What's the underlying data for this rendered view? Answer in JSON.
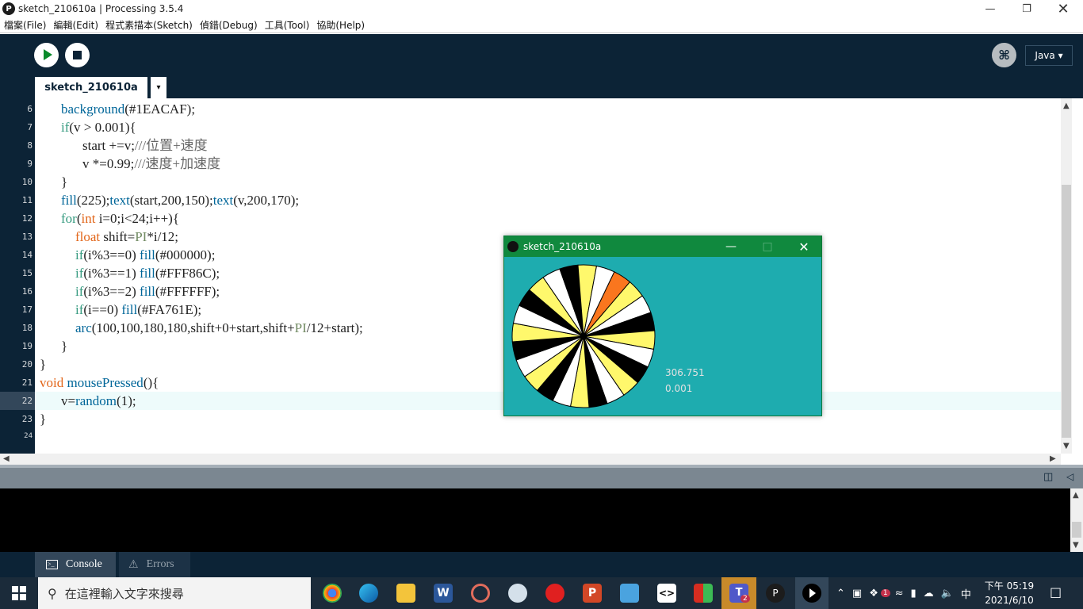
{
  "window": {
    "title": "sketch_210610a | Processing 3.5.4",
    "logo": "P"
  },
  "menu": [
    "檔案(File)",
    "編輯(Edit)",
    "程式素描本(Sketch)",
    "偵錯(Debug)",
    "工具(Tool)",
    "協助(Help)"
  ],
  "toolbar": {
    "mode_label": "Java ▾",
    "run_icon": "play-icon",
    "stop_icon": "stop-icon",
    "debug_icon": "butterfly-icon"
  },
  "tab": {
    "name": "sketch_210610a",
    "menu_glyph": "▾"
  },
  "code": {
    "line_numbers": [
      "6",
      "7",
      "8",
      "9",
      "10",
      "11",
      "12",
      "13",
      "14",
      "15",
      "16",
      "17",
      "18",
      "19",
      "20",
      "21",
      "22",
      "23",
      "24"
    ],
    "active_line": "22",
    "l6": {
      "fn": "background",
      "rest": "(#1EACAF);"
    },
    "l7": {
      "kw": "if",
      "rest": "(v > 0.001){"
    },
    "l8": {
      "code": "start +=v;",
      "comment": "///位置+速度"
    },
    "l9": {
      "code": "v *=0.99;",
      "comment": "///速度+加速度"
    },
    "l10": "}",
    "l11": {
      "fn1": "fill",
      "a1": "(225);",
      "fn2": "text",
      "a2": "(start,200,150);",
      "fn3": "text",
      "a3": "(v,200,170);"
    },
    "l12": {
      "kw": "for",
      "p1": "(",
      "ty": "int",
      "rest": " i=0;i<24;i++){"
    },
    "l13": {
      "ty": "float",
      "mid": " shift=",
      "const": "PI",
      "rest": "*i/12;"
    },
    "l14": {
      "kw": "if",
      "a": "(i%3==0) ",
      "fn": "fill",
      "b": "(#000000);"
    },
    "l15": {
      "kw": "if",
      "a": "(i%3==1) ",
      "fn": "fill",
      "b": "(#FFF86C);"
    },
    "l16": {
      "kw": "if",
      "a": "(i%3==2) ",
      "fn": "fill",
      "b": "(#FFFFFF);"
    },
    "l17": {
      "kw": "if",
      "a": "(i==0) ",
      "fn": "fill",
      "b": "(#FA761E);"
    },
    "l18": {
      "fn": "arc",
      "a": "(100,100,180,180,shift+0+start,shift+",
      "const": "PI",
      "b": "/12+start);"
    },
    "l19": "}",
    "l20": "}",
    "l21": {
      "ty": "void",
      "fn": "mousePressed",
      "rest": "(){"
    },
    "l22": {
      "a": "v=",
      "fn": "random",
      "b": "(1);"
    },
    "l23": "}"
  },
  "sketch_window": {
    "title": "sketch_210610a",
    "text_start": "306.751",
    "text_v": "0.001",
    "colors": {
      "bg": "#1EACAF",
      "black": "#000000",
      "yellow": "#FFF86C",
      "white": "#FFFFFF",
      "orange": "#FA761E"
    }
  },
  "console": {
    "tab_console": "Console",
    "tab_errors": "Errors"
  },
  "taskbar": {
    "search_placeholder": "在這裡輸入文字來搜尋",
    "ime": "中",
    "time": "下午 05:19",
    "date": "2021/6/10",
    "teams_badge": "2",
    "badge_1": "1"
  }
}
